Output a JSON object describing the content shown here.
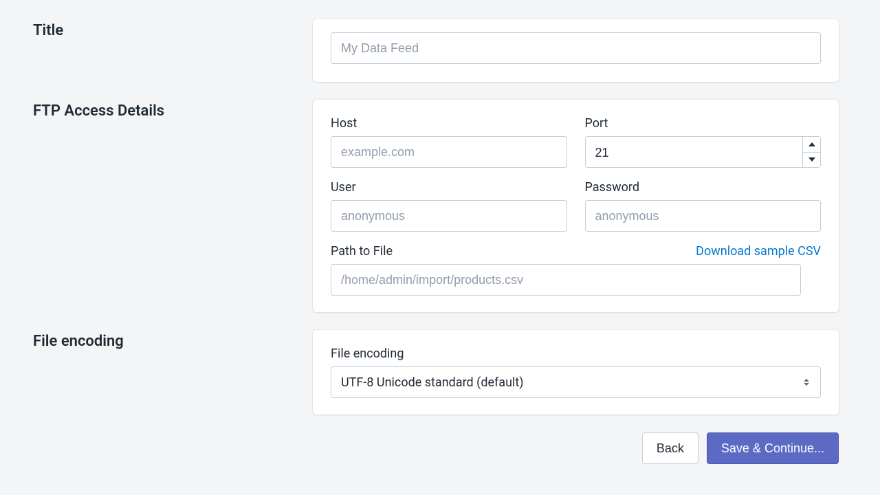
{
  "sections": {
    "title": {
      "label": "Title",
      "placeholder": "My Data Feed",
      "value": ""
    },
    "ftp": {
      "label": "FTP Access Details",
      "host": {
        "label": "Host",
        "placeholder": "example.com",
        "value": ""
      },
      "port": {
        "label": "Port",
        "value": "21"
      },
      "user": {
        "label": "User",
        "placeholder": "anonymous",
        "value": ""
      },
      "password": {
        "label": "Password",
        "placeholder": "anonymous",
        "value": ""
      },
      "path": {
        "label": "Path to File",
        "placeholder": "/home/admin/import/products.csv",
        "value": ""
      },
      "download_link": "Download sample CSV"
    },
    "encoding": {
      "label": "File encoding",
      "field_label": "File encoding",
      "selected": "UTF-8 Unicode standard (default)"
    }
  },
  "actions": {
    "back": "Back",
    "save": "Save & Continue..."
  }
}
